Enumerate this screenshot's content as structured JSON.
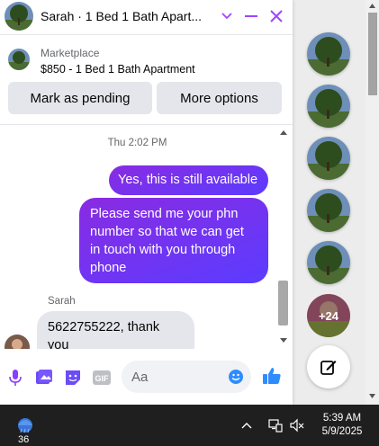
{
  "chat": {
    "title": "Sarah · 1 Bed 1 Bath Apart...",
    "marketplace_label": "Marketplace",
    "listing": "$850 - 1 Bed 1 Bath Apartment",
    "actions": [
      "Mark as pending",
      "More options"
    ],
    "timestamp": "Thu 2:02 PM",
    "messages": [
      {
        "from": "me",
        "text": "Yes, this is still available"
      },
      {
        "from": "me",
        "text": "Please send me your phn number so that we can get in touch with you through phone"
      },
      {
        "from": "Sarah",
        "sender_label": "Sarah",
        "text": "5622755222, thank you"
      }
    ],
    "composer_placeholder": "Aa",
    "colors": {
      "accent": "#0084ff",
      "bubble_start": "#8a2be2",
      "bubble_end": "#5b3cff"
    }
  },
  "rail": {
    "more_count": "+24",
    "compose_icon": "compose-icon"
  },
  "taskbar": {
    "weather_temp": "36",
    "time": "5:39 AM",
    "date": "5/9/2025"
  }
}
